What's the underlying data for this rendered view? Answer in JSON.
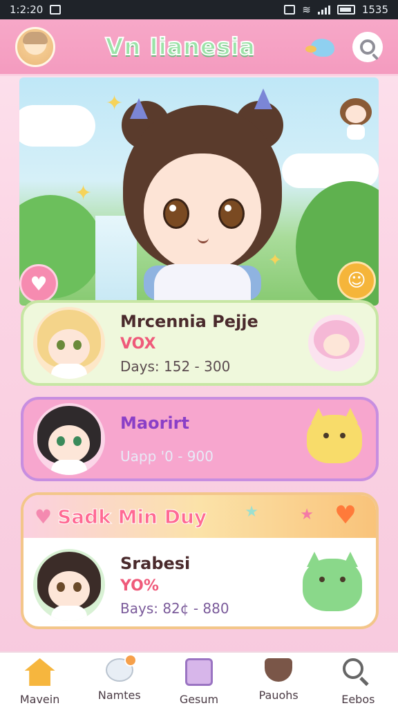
{
  "status_bar": {
    "time": "1:2:20",
    "battery_level": "1535"
  },
  "header": {
    "title": "Vn Iianesia"
  },
  "hero": {
    "heart_symbol": "♥",
    "badge_symbol": "☺"
  },
  "cards": [
    {
      "name": "Mrcennia Pejje",
      "tag": "VOX",
      "days": "Days: 152 - 300"
    },
    {
      "name": "Maorirt",
      "tag": "",
      "days": "Uapp '0 - 900"
    },
    {
      "banner": "Sadk Min Duy",
      "name": "Srabesi",
      "tag": "YO%",
      "days": "Bays: 82¢ - 880"
    }
  ],
  "bottom_nav": [
    {
      "label": "Mavein",
      "icon": "home-icon"
    },
    {
      "label": "Namtes",
      "icon": "chat-icon"
    },
    {
      "label": "Gesum",
      "icon": "book-icon"
    },
    {
      "label": "Pauohs",
      "icon": "cup-icon"
    },
    {
      "label": "Eebos",
      "icon": "search-icon"
    }
  ],
  "colors": {
    "header": "#f49bbf",
    "title": "#9be3a8",
    "accent_pink": "#ef5a7a",
    "card2_name": "#8a3fc7"
  }
}
